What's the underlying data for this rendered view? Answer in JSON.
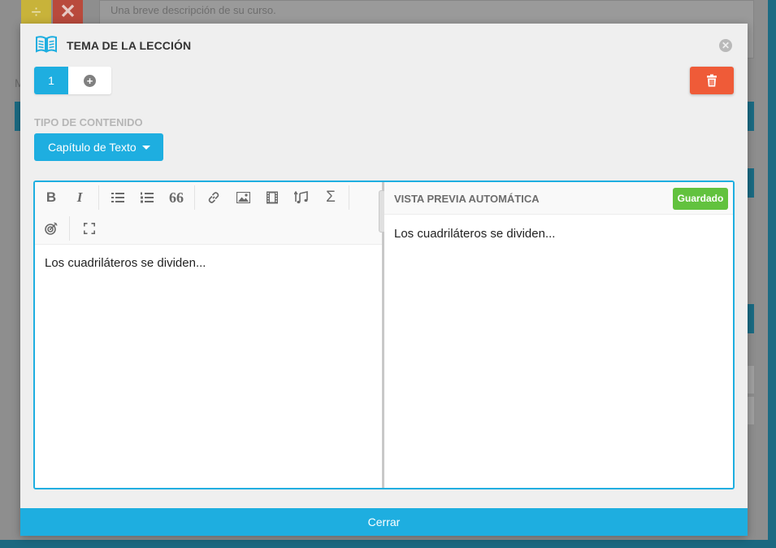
{
  "background": {
    "description_placeholder": "Una breve descripción de su curso.",
    "divide_symbol": "÷",
    "close_symbol": "✕",
    "side_letter": "M"
  },
  "modal": {
    "title": "TEMA DE LA LECCIÓN",
    "close_glyph": "✕",
    "tabs": {
      "active_label": "1",
      "add_glyph": "+"
    },
    "content_type": {
      "label": "TIPO DE CONTENIDO",
      "selected": "Capítulo de Texto"
    },
    "toolbar": {
      "bold": "B",
      "italic": "I",
      "quote": "66",
      "sigma": "Σ"
    },
    "editor": {
      "text": "Los cuadriláteros se dividen..."
    },
    "preview": {
      "title": "VISTA PREVIA AUTOMÁTICA",
      "status": "Guardado",
      "text": "Los cuadriláteros se dividen..."
    },
    "footer": {
      "close_label": "Cerrar"
    }
  },
  "colors": {
    "accent": "#1eaee0",
    "danger": "#ef5b38",
    "success": "#62c23e"
  }
}
